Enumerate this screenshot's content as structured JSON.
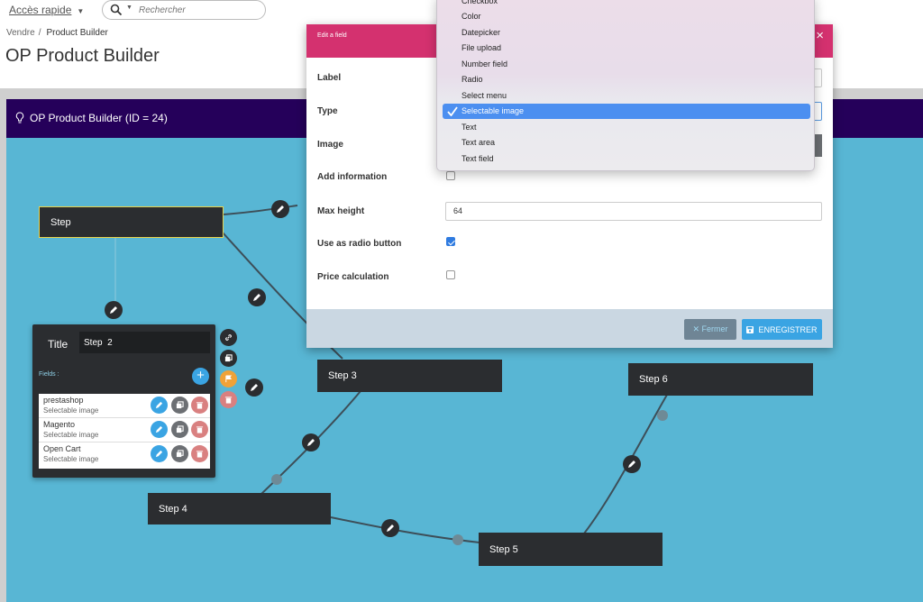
{
  "header": {
    "quick_access": "Accès rapide",
    "search_placeholder": "Rechercher",
    "breadcrumb": [
      "Vendre",
      "Product Builder"
    ],
    "page_title": "OP Product Builder"
  },
  "builder": {
    "title": "OP Product Builder (ID = 24)",
    "steps": [
      "Step",
      "Step 3",
      "Step 4",
      "Step 5",
      "Step 6"
    ]
  },
  "editor": {
    "title_label": "Title",
    "title_value": "Step  2",
    "fields_label": "Fields :",
    "add_label": "+",
    "fields": [
      {
        "name": "prestashop",
        "type": "Selectable image"
      },
      {
        "name": "Magento",
        "type": "Selectable image"
      },
      {
        "name": "Open Cart",
        "type": "Selectable image"
      }
    ]
  },
  "modal": {
    "title": "Edit a field",
    "close_glyph": "×",
    "labels": {
      "label": "Label",
      "type": "Type",
      "image": "Image",
      "add_information": "Add information",
      "max_height": "Max height",
      "use_as_radio": "Use as radio button",
      "price_calculation": "Price calculation"
    },
    "max_height_value": "64",
    "add_information_checked": false,
    "use_as_radio_checked": true,
    "price_calculation_checked": false,
    "close_button": "✕  Fermer",
    "save_button": "ENREGISTRER"
  },
  "dropdown": {
    "options": [
      "Checkbox",
      "Color",
      "Datepicker",
      "File upload",
      "Number field",
      "Radio",
      "Select menu",
      "Selectable image",
      "Text",
      "Text area",
      "Text field"
    ],
    "selected": "Selectable image"
  },
  "colors": {
    "modal_header": "#d4316f",
    "builder_header": "#25005a",
    "canvas": "#58b6d4",
    "accent_blue": "#3aa4e3",
    "selection_blue": "#4c8ff0"
  }
}
